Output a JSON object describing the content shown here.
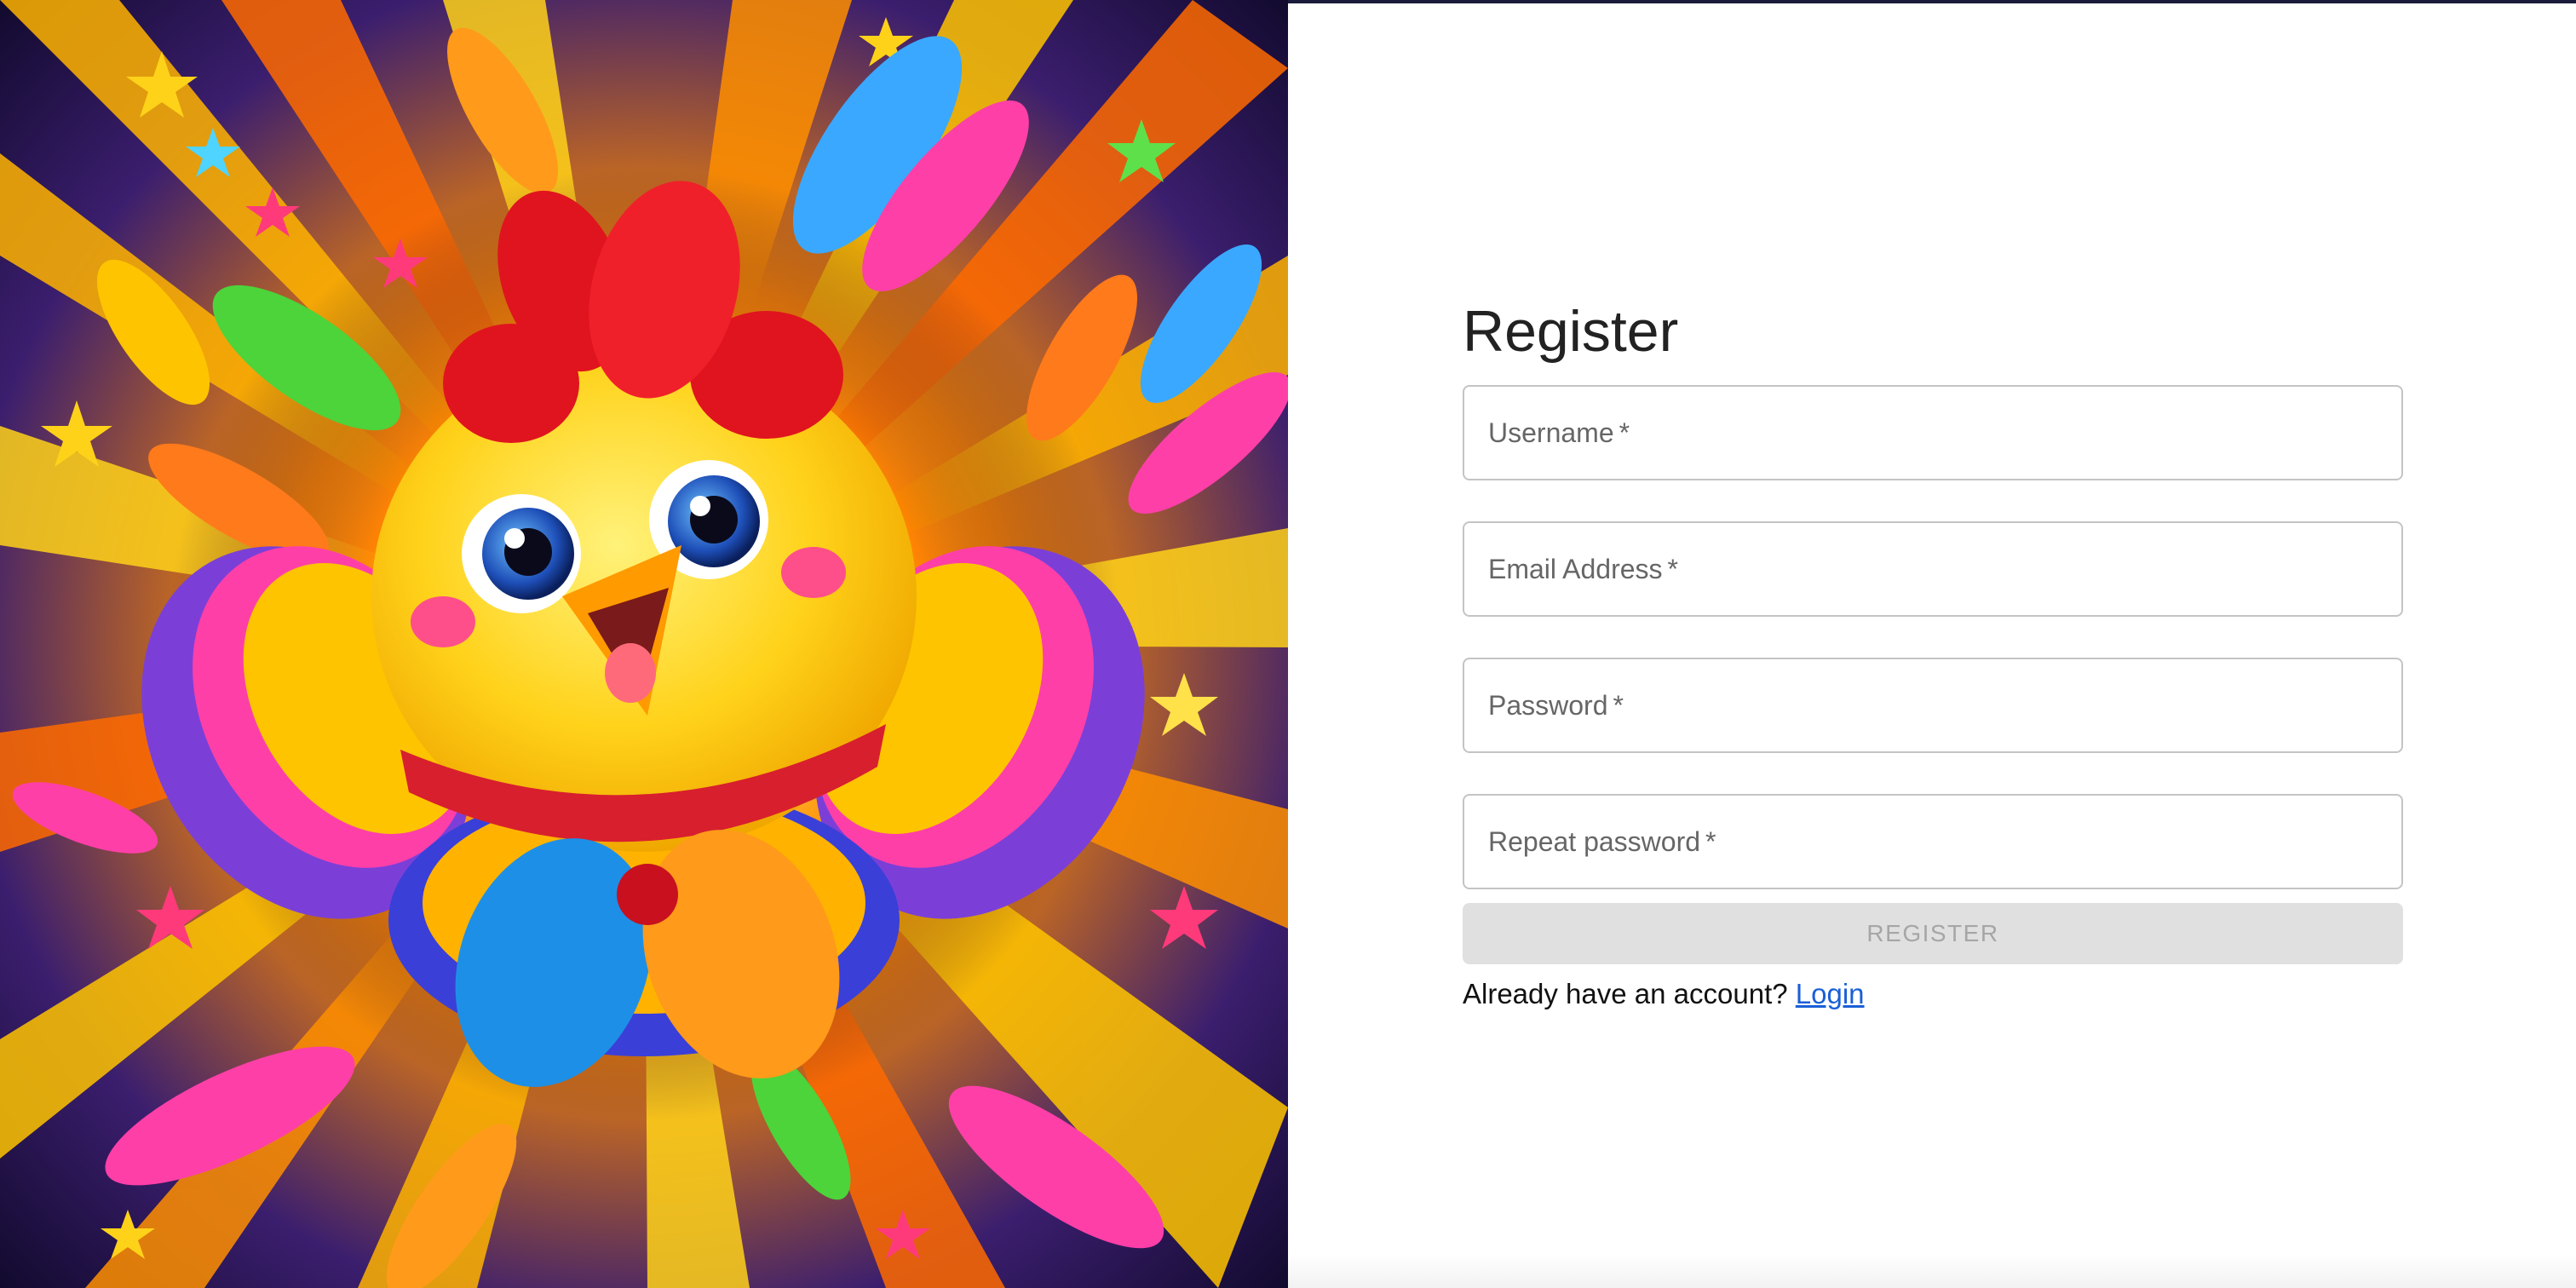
{
  "hero": {
    "image_alt": "Colorful cartoon chick with red crest, rainbow wings, feathers and stars bursting",
    "colors": {
      "chick_body": "#ffd21a",
      "crest": "#e0141e",
      "scarf": "#d81f2e",
      "bow_blue": "#1e8fe6",
      "bow_orange": "#ff9a1a",
      "burst_inner": "#fff6b0",
      "burst_outer": "#120a2e"
    }
  },
  "form": {
    "title": "Register",
    "fields": [
      {
        "label": "Username",
        "required_mark": "*",
        "value": "",
        "type": "text"
      },
      {
        "label": "Email Address",
        "required_mark": "*",
        "value": "",
        "type": "email"
      },
      {
        "label": "Password",
        "required_mark": "*",
        "value": "",
        "type": "password"
      },
      {
        "label": "Repeat password",
        "required_mark": "*",
        "value": "",
        "type": "password"
      }
    ],
    "submit_label": "REGISTER",
    "submit_disabled": true,
    "login_prompt": "Already have an account?",
    "login_link": "Login"
  },
  "colors": {
    "link": "#1a5fd6",
    "button_bg_disabled": "#e0e0e0",
    "button_text_disabled": "#a6a6a6",
    "field_border": "#c4c4c4",
    "label_text": "#666666"
  }
}
